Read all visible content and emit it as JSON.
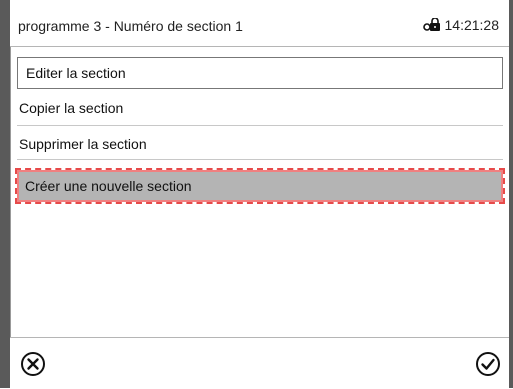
{
  "header": {
    "title": "programme 3 - Numéro de section 1",
    "time": "14:21:28",
    "lock_icon": "padlock-icon"
  },
  "menu": {
    "items": [
      {
        "label": "Editer la section"
      },
      {
        "label": "Copier la section"
      },
      {
        "label": "Supprimer la section"
      },
      {
        "label": "Créer une nouvelle section",
        "selected": true
      }
    ]
  },
  "footer": {
    "cancel_icon": "cancel-icon",
    "confirm_icon": "checkmark-icon"
  },
  "colors": {
    "selected_bg": "#b4b4b4",
    "selected_outline": "#e74a4a",
    "side_bar": "#5a5a5a"
  }
}
